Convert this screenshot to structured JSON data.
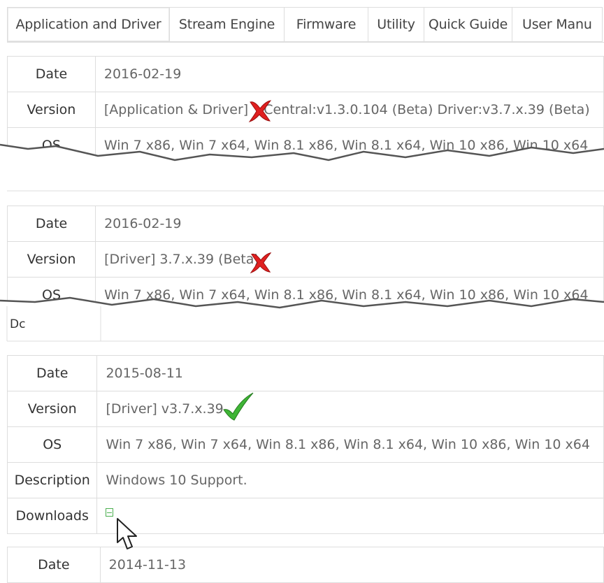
{
  "tabs": [
    {
      "label": "Application and Driver"
    },
    {
      "label": "Stream Engine"
    },
    {
      "label": "Firmware"
    },
    {
      "label": "Utility"
    },
    {
      "label": "Quick Guide"
    },
    {
      "label": "User Manu"
    }
  ],
  "labels": {
    "date": "Date",
    "version": "Version",
    "os": "OS",
    "description": "Description",
    "downloads": "Downloads",
    "ds_fragment": "Dc"
  },
  "records": [
    {
      "date": "2016-02-19",
      "version_prefix": "[Application & Driver] ",
      "version_rest": "Central:v1.3.0.104 (Beta) Driver:v3.7.x.39 (Beta)",
      "os": "Win 7 x86, Win 7 x64, Win 8.1 x86, Win 8.1 x64, Win 10 x86, Win 10 x64",
      "status_mark": "red-x-icon"
    },
    {
      "date": "2016-02-19",
      "version": "[Driver] 3.7.x.39 (Beta)",
      "os": "Win 7 x86, Win 7 x64, Win 8.1 x86, Win 8.1 x64, Win 10 x86, Win 10 x64",
      "status_mark": "red-x-icon"
    },
    {
      "date": "2015-08-11",
      "version": "[Driver] v3.7.x.39",
      "os": "Win 7 x86, Win 7 x64, Win 8.1 x86, Win 8.1 x64, Win 10 x86, Win 10 x64",
      "description": "Windows 10 Support.",
      "downloads_icon": "floppy-disk-icon",
      "status_mark": "green-check-icon"
    },
    {
      "date": "2014-11-13"
    }
  ],
  "colors": {
    "border": "#dddddd",
    "text": "#333333",
    "value_text": "#666666",
    "red_mark": "#e02020",
    "green_mark": "#3fb536",
    "download_icon": "#4caf50"
  }
}
